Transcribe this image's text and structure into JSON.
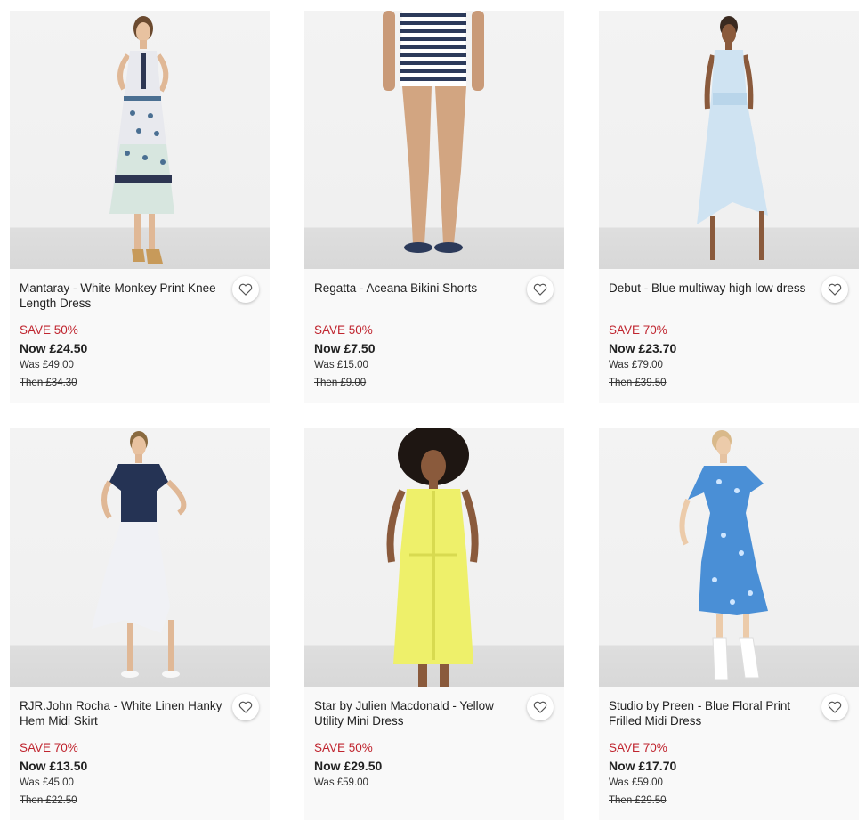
{
  "products": [
    {
      "title": "Mantaray - White Monkey Print Knee Length Dress",
      "save": "SAVE 50%",
      "now": "Now £24.50",
      "was": "Was £49.00",
      "then": "Then £34.30",
      "image": "model-white-monkey-print-dress"
    },
    {
      "title": "Regatta - Aceana Bikini Shorts",
      "save": "SAVE 50%",
      "now": "Now £7.50",
      "was": "Was £15.00",
      "then": "Then £9.00",
      "image": "model-striped-bikini-shorts"
    },
    {
      "title": "Debut - Blue multiway high low dress",
      "save": "SAVE 70%",
      "now": "Now £23.70",
      "was": "Was £79.00",
      "then": "Then £39.50",
      "image": "model-blue-high-low-dress"
    },
    {
      "title": "RJR.John Rocha - White Linen Hanky Hem Midi Skirt",
      "save": "SAVE 70%",
      "now": "Now £13.50",
      "was": "Was £45.00",
      "then": "Then £22.50",
      "image": "model-white-linen-skirt"
    },
    {
      "title": "Star by Julien Macdonald - Yellow Utility Mini Dress",
      "save": "SAVE 50%",
      "now": "Now £29.50",
      "was": "Was £59.00",
      "image": "model-yellow-utility-dress"
    },
    {
      "title": "Studio by Preen - Blue Floral Print Frilled Midi Dress",
      "save": "SAVE 70%",
      "now": "Now £17.70",
      "was": "Was £59.00",
      "then": "Then £29.50",
      "image": "model-blue-floral-dress"
    }
  ],
  "colors": {
    "save": "#c0252f",
    "card_bg": "#f9f9f9",
    "text": "#222222"
  },
  "icons": {
    "favourite": "heart-outline-icon"
  }
}
